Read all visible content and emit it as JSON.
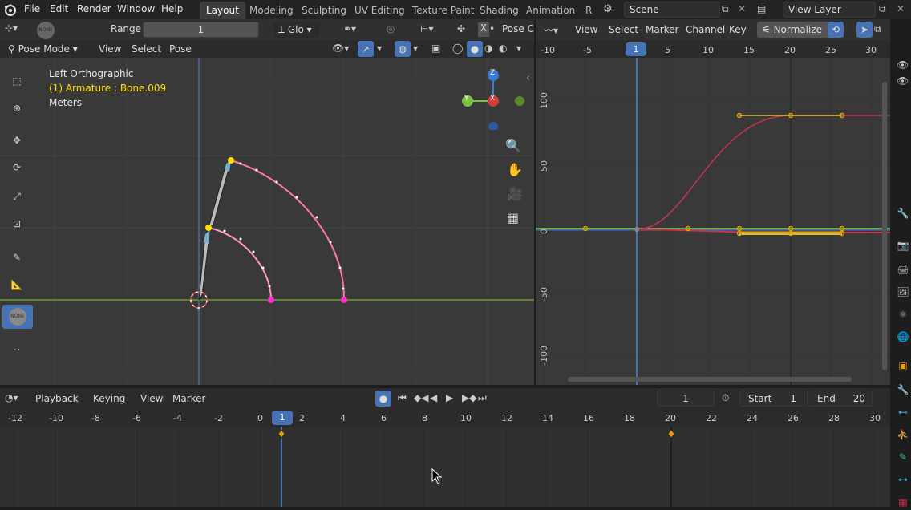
{
  "menu": {
    "file": "File",
    "edit": "Edit",
    "render": "Render",
    "window": "Window",
    "help": "Help"
  },
  "workspaces": [
    "Layout",
    "Modeling",
    "Sculpting",
    "UV Editing",
    "Texture Paint",
    "Shading",
    "Animation",
    "R"
  ],
  "scene": {
    "name": "Scene",
    "view_layer": "View Layer"
  },
  "tool_header": {
    "range_label": "Range",
    "range_value": "1",
    "orientation": "Glo",
    "pose_clip": "Pose C",
    "mirror_x": "X",
    "avatar": "NONE"
  },
  "viewport_header": {
    "mode": "Pose Mode",
    "view": "View",
    "select": "Select",
    "pose": "Pose"
  },
  "overlay": {
    "view_name": "Left Orthographic",
    "object": "(1) Armature : Bone.009",
    "units": "Meters"
  },
  "gizmo": {
    "z": "Z",
    "y": "Y",
    "x": "X"
  },
  "graph_header": {
    "view": "View",
    "select": "Select",
    "marker": "Marker",
    "channel": "Channel",
    "key": "Key",
    "normalize": "Normalize"
  },
  "graph_frames": [
    "-10",
    "-5",
    "1",
    "5",
    "10",
    "15",
    "20",
    "25",
    "30"
  ],
  "graph_values": [
    "100",
    "50",
    "0",
    "-50",
    "-100"
  ],
  "timeline_header": {
    "playback": "Playback",
    "keying": "Keying",
    "view": "View",
    "marker": "Marker",
    "current_frame": "1",
    "start_label": "Start",
    "start": "1",
    "end_label": "End",
    "end": "20"
  },
  "timeline_frames": [
    "-12",
    "-10",
    "-8",
    "-6",
    "-4",
    "-2",
    "0",
    "1",
    "2",
    "4",
    "6",
    "8",
    "10",
    "12",
    "14",
    "16",
    "18",
    "20",
    "22",
    "24",
    "26",
    "28",
    "30"
  ],
  "colors": {
    "accent": "#4772b3",
    "bone_yellow": "#ffe000",
    "arc_pink": "#ff33cc",
    "keyframe": "#e8a000",
    "curve_red": "#c8334f",
    "axis_green": "#6a9a2a"
  }
}
